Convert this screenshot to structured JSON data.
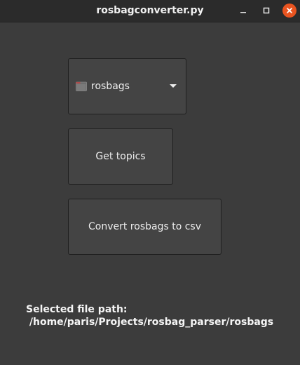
{
  "window": {
    "title": "rosbagconverter.py"
  },
  "folder_chooser": {
    "label": "rosbags"
  },
  "buttons": {
    "get_topics": "Get topics",
    "convert": "Convert rosbags to csv"
  },
  "selected": {
    "heading": "Selected file path:",
    "path": " /home/paris/Projects/rosbag_parser/rosbags"
  },
  "colors": {
    "close_button": "#e95420",
    "background": "#3c3c3c"
  }
}
